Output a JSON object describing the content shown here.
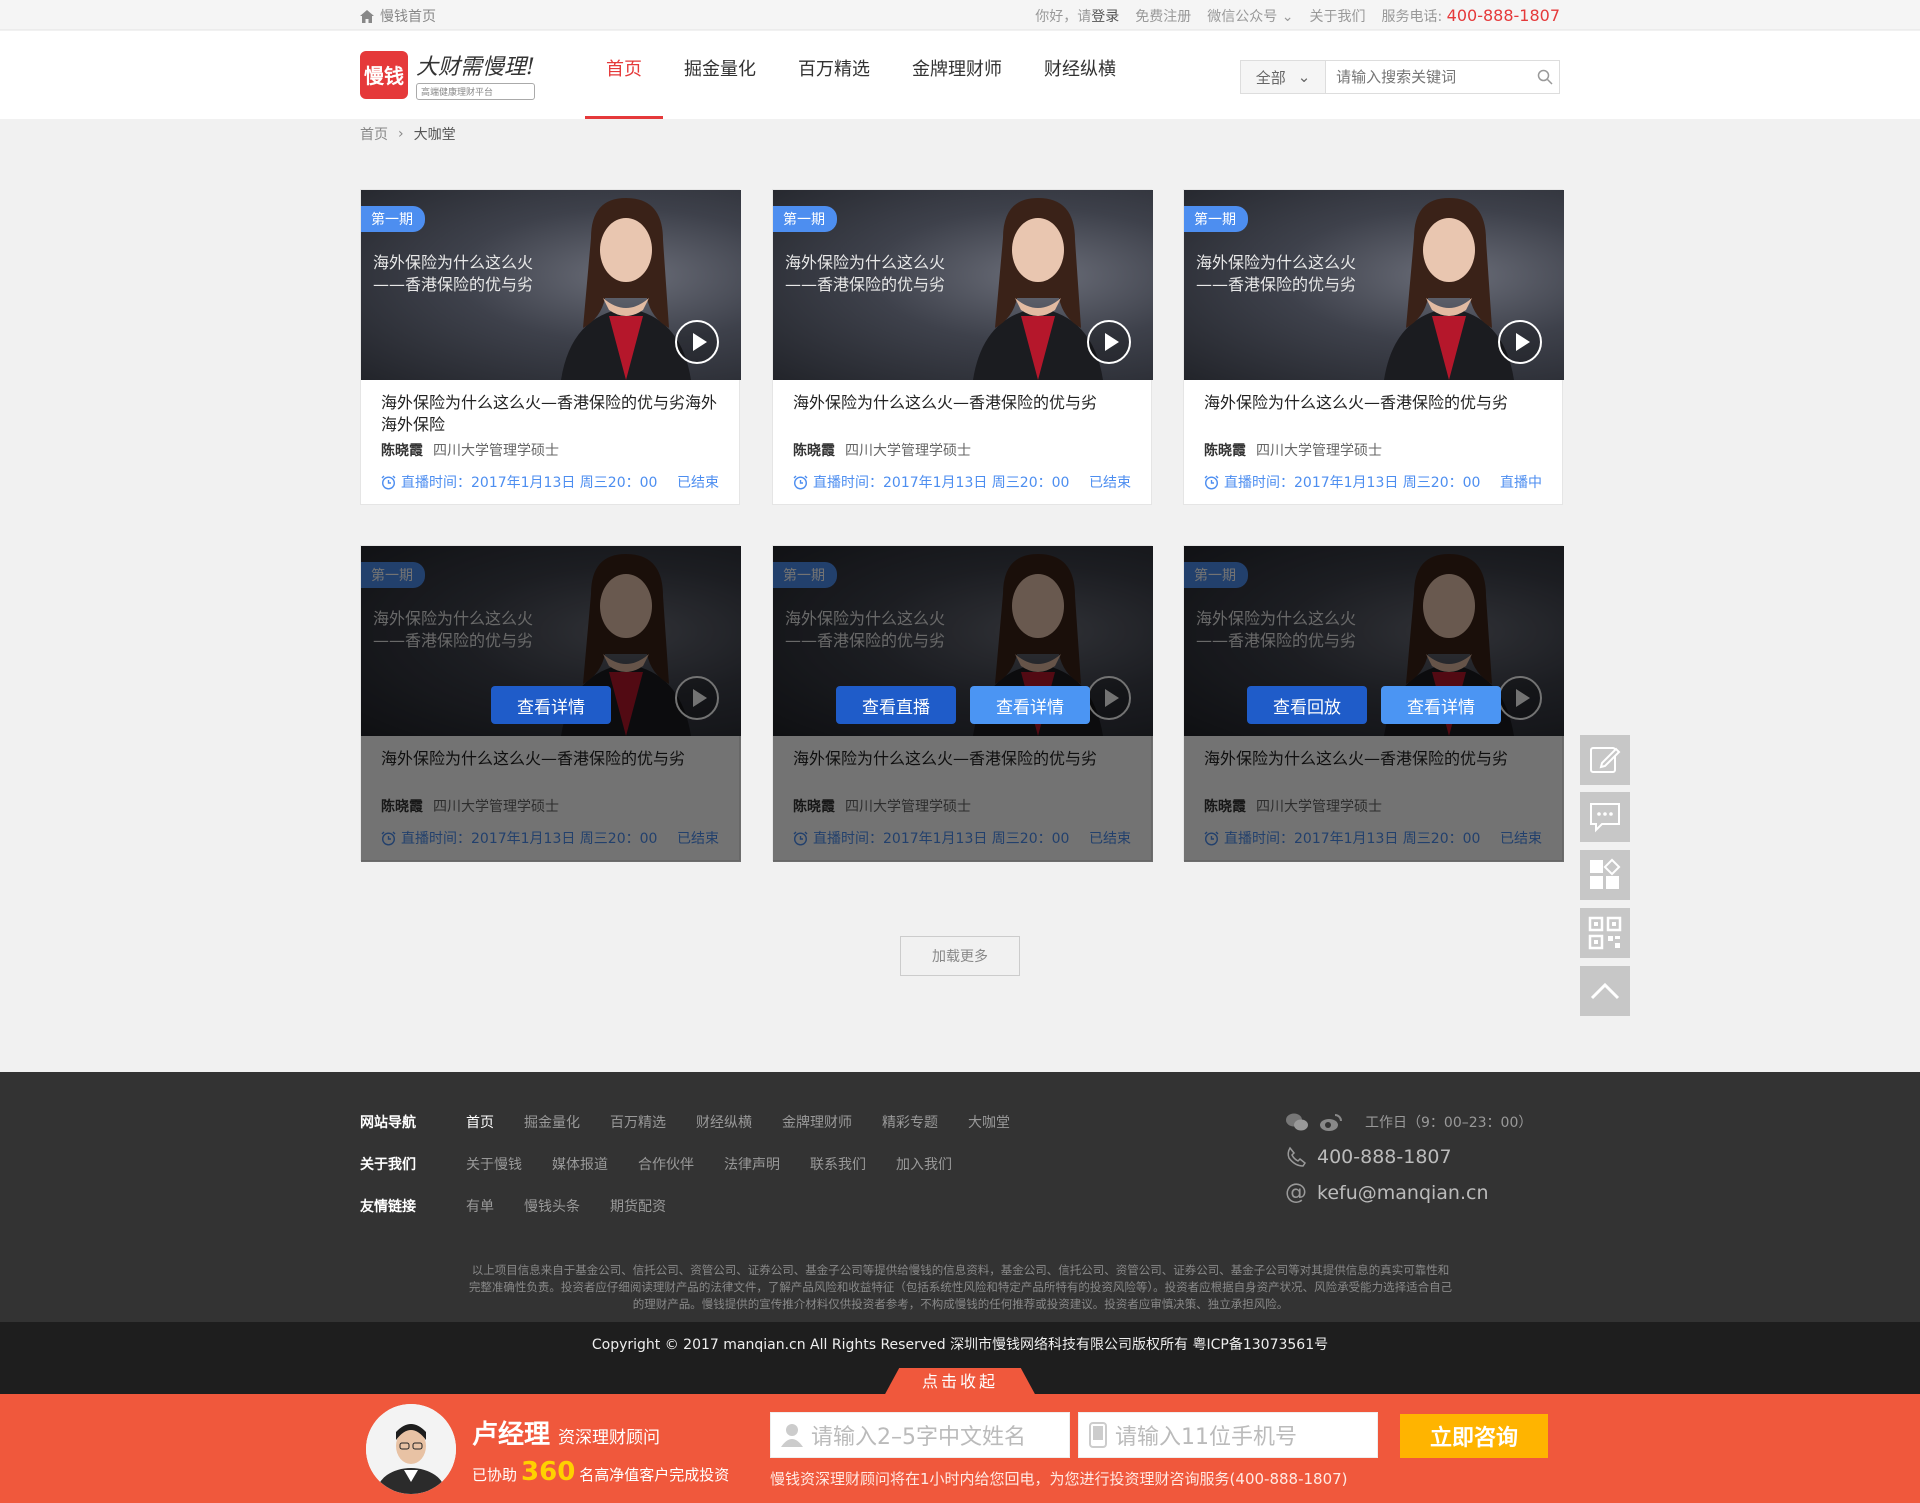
{
  "topbar": {
    "home": "慢钱首页",
    "greeting": "你好，请",
    "login": "登录",
    "register": "免费注册",
    "wechat": "微信公众号",
    "about": "关于我们",
    "service_label": "服务电话:",
    "service_phone": "400-888-1807"
  },
  "brand": {
    "mark": "慢钱",
    "slogan": "大财需慢理!",
    "sub": "高端健康理财平台"
  },
  "nav": [
    {
      "label": "首页",
      "active": true
    },
    {
      "label": "掘金量化"
    },
    {
      "label": "百万精选"
    },
    {
      "label": "金牌理财师"
    },
    {
      "label": "财经纵横"
    }
  ],
  "search": {
    "category": "全部",
    "placeholder": "请输入搜索关键词"
  },
  "breadcrumb": {
    "home": "首页",
    "current": "大咖堂"
  },
  "cards": [
    {
      "badge": "第一期",
      "thumb_title": "海外保险为什么这么火\n——香港保险的优与劣",
      "title": "海外保险为什么这么火—香港保险的优与劣海外海外保险",
      "author": "陈晓霞",
      "degree": "四川大学管理学硕士",
      "time": "直播时间：2017年1月13日 周三20：00",
      "status": "已结束"
    },
    {
      "badge": "第一期",
      "thumb_title": "海外保险为什么这么火\n——香港保险的优与劣",
      "title": "海外保险为什么这么火—香港保险的优与劣",
      "author": "陈晓霞",
      "degree": "四川大学管理学硕士",
      "time": "直播时间：2017年1月13日 周三20：00",
      "status": "已结束"
    },
    {
      "badge": "第一期",
      "thumb_title": "海外保险为什么这么火\n——香港保险的优与劣",
      "title": "海外保险为什么这么火—香港保险的优与劣",
      "author": "陈晓霞",
      "degree": "四川大学管理学硕士",
      "time": "直播时间：2017年1月13日 周三20：00",
      "status": "直播中"
    },
    {
      "badge": "第一期",
      "thumb_title": "海外保险为什么这么火\n——香港保险的优与劣",
      "title": "海外保险为什么这么火—香港保险的优与劣",
      "author": "陈晓霞",
      "degree": "四川大学管理学硕士",
      "time": "直播时间：2017年1月13日 周三20：00",
      "status": "已结束",
      "buttons": [
        "查看详情"
      ]
    },
    {
      "badge": "第一期",
      "thumb_title": "海外保险为什么这么火\n——香港保险的优与劣",
      "title": "海外保险为什么这么火—香港保险的优与劣",
      "author": "陈晓霞",
      "degree": "四川大学管理学硕士",
      "time": "直播时间：2017年1月13日 周三20：00",
      "status": "已结束",
      "buttons": [
        "查看直播",
        "查看详情"
      ]
    },
    {
      "badge": "第一期",
      "thumb_title": "海外保险为什么这么火\n——香港保险的优与劣",
      "title": "海外保险为什么这么火—香港保险的优与劣",
      "author": "陈晓霞",
      "degree": "四川大学管理学硕士",
      "time": "直播时间：2017年1月13日 周三20：00",
      "status": "已结束",
      "buttons": [
        "查看回放",
        "查看详情"
      ]
    }
  ],
  "load_more": "加载更多",
  "side_icons": [
    "edit-icon",
    "chat-icon",
    "apps-icon",
    "qrcode-icon",
    "back-to-top-icon"
  ],
  "footer": {
    "rows": [
      {
        "label": "网站导航",
        "links": [
          "首页",
          "掘金量化",
          "百万精选",
          "财经纵横",
          "金牌理财师",
          "精彩专题",
          "大咖堂"
        ]
      },
      {
        "label": "关于我们",
        "links": [
          "关于慢钱",
          "媒体报道",
          "合作伙伴",
          "法律声明",
          "联系我们",
          "加入我们"
        ]
      },
      {
        "label": "友情链接",
        "links": [
          "有单",
          "慢钱头条",
          "期货配资"
        ]
      }
    ],
    "hours": "工作日（9：00–23：00）",
    "phone": "400-888-1807",
    "email": "kefu@manqian.cn",
    "disclaimer": "以上项目信息来自于基金公司、信托公司、资管公司、证券公司、基金子公司等提供给慢钱的信息资料，基金公司、信托公司、资管公司、证券公司、基金子公司等对其提供信息的真实可靠性和完整准确性负责。投资者应仔细阅读理财产品的法律文件，了解产品风险和收益特征（包括系统性风险和特定产品所特有的投资风险等）。投资者应根据自身资产状况、风险承受能力选择适合自己的理财产品。慢钱提供的宣传推介材料仅供投资者参考，不构成慢钱的任何推荐或投资建议。投资者应审慎决策、独立承担风险。",
    "copyright": "Copyright © 2017 manqian.cn All Rights Reserved 深圳市慢钱网络科技有限公司版权所有 粤ICP备13073561号"
  },
  "consult": {
    "collapse": "点击收起",
    "name": "卢经理",
    "role": "资深理财顾问",
    "helped_prefix": "已协助",
    "helped_count": "360",
    "helped_suffix": "名高净值客户完成投资",
    "name_placeholder": "请输入2–5字中文姓名",
    "phone_placeholder": "请输入11位手机号",
    "submit": "立即咨询",
    "hint": "慢钱资深理财顾问将在1小时内给您回电，为您进行投资理财咨询服务(400-888-1807)"
  },
  "colors": {
    "brand_red": "#e5393a",
    "link_blue": "#4d8ef0",
    "button_blue_dark": "#1f5cc9",
    "button_blue_light": "#4b95f3",
    "consult_bar": "#f0583c",
    "submit_yellow": "#ffb400"
  }
}
